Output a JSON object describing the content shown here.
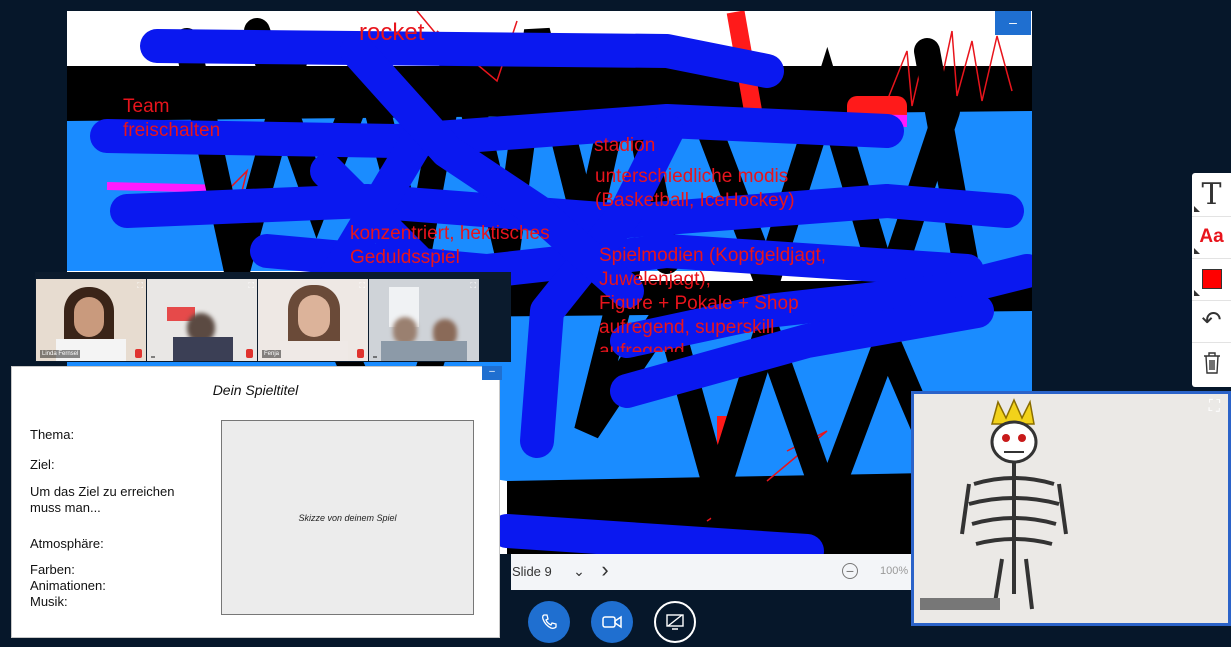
{
  "whiteboard": {
    "annotations": [
      "rocket",
      "Team\nfreischalten",
      "stadion",
      "unterschiedliche modis\n(Basketball, IceHockey)",
      "konzentriert, hektisches\nGeduldsspiel",
      "Spielmodien (Kopfgeldjagt,\nJuwelenjagt),\nFigure + Pokale + Shop\naufregend, superskill\naufregend"
    ],
    "minimize_icon": "minimize-icon"
  },
  "slide_bar": {
    "label": "Slide 9",
    "dropdown_icon": "chevron-down-icon",
    "next_icon": "chevron-right-icon",
    "zoom_out_icon": "zoom-out-icon",
    "zoom_level": "100%"
  },
  "controls": {
    "audio_icon": "phone-icon",
    "video_icon": "video-camera-icon",
    "share_icon": "screen-share-icon"
  },
  "video_strip": {
    "tiles": [
      {
        "name": "Linda Fernsel"
      },
      {
        "name": ""
      },
      {
        "name": "Fenja"
      },
      {
        "name": ""
      }
    ]
  },
  "worksheet": {
    "title": "Dein Spieltitel",
    "fields": [
      "Thema:",
      "Ziel:",
      "Um das Ziel zu erreichen\nmuss man...",
      "Atmosphäre:",
      "Farben:\nAnimationen:\nMusik:"
    ],
    "sketch_label": "Skizze von deinem Spiel"
  },
  "toolbar": {
    "text_tool": "T",
    "font_tool": "Aa",
    "color": "#ff0000",
    "undo_icon": "undo-icon",
    "delete_icon": "trash-icon"
  },
  "webcam": {
    "expand_icon": "fullscreen-icon"
  },
  "colors": {
    "accent": "#1f6fd0",
    "annotation": "#e8141c",
    "background": "#06172a"
  }
}
